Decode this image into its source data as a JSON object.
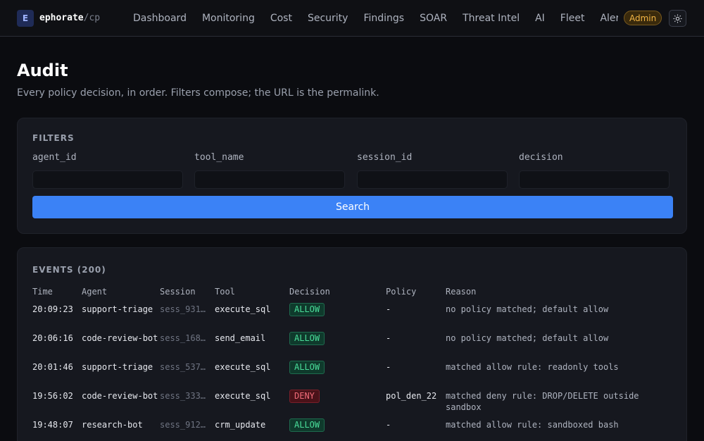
{
  "brand": {
    "logo_letter": "E",
    "name": "ephorate",
    "sep": "/",
    "sub": "cp"
  },
  "nav": [
    {
      "label": "Dashboard"
    },
    {
      "label": "Monitoring"
    },
    {
      "label": "Cost"
    },
    {
      "label": "Security"
    },
    {
      "label": "Findings"
    },
    {
      "label": "SOAR"
    },
    {
      "label": "Threat Intel"
    },
    {
      "label": "AI"
    },
    {
      "label": "Fleet"
    },
    {
      "label": "Aler"
    }
  ],
  "admin_badge": "Admin",
  "theme_icon": "sun-icon",
  "page": {
    "title": "Audit",
    "subtitle": "Every policy decision, in order. Filters compose; the URL is the permalink."
  },
  "filters": {
    "heading": "FILTERS",
    "fields": [
      {
        "label": "agent_id",
        "value": ""
      },
      {
        "label": "tool_name",
        "value": ""
      },
      {
        "label": "session_id",
        "value": ""
      },
      {
        "label": "decision",
        "value": ""
      }
    ],
    "search_label": "Search"
  },
  "events": {
    "heading": "EVENTS (200)",
    "columns": [
      "Time",
      "Agent",
      "Session",
      "Tool",
      "Decision",
      "Policy",
      "Reason"
    ],
    "rows": [
      {
        "time": "20:09:23",
        "agent": "support-triage",
        "session": "sess_931…",
        "tool": "execute_sql",
        "decision": "ALLOW",
        "policy": "-",
        "reason": "no policy matched; default allow"
      },
      {
        "time": "20:06:16",
        "agent": "code-review-bot",
        "session": "sess_168…",
        "tool": "send_email",
        "decision": "ALLOW",
        "policy": "-",
        "reason": "no policy matched; default allow"
      },
      {
        "time": "20:01:46",
        "agent": "support-triage",
        "session": "sess_537…",
        "tool": "execute_sql",
        "decision": "ALLOW",
        "policy": "-",
        "reason": "matched allow rule: readonly tools"
      },
      {
        "time": "19:56:02",
        "agent": "code-review-bot",
        "session": "sess_333…",
        "tool": "execute_sql",
        "decision": "DENY",
        "policy": "pol_den_22",
        "reason": "matched deny rule: DROP/DELETE outside sandbox"
      },
      {
        "time": "19:48:07",
        "agent": "research-bot",
        "session": "sess_912…",
        "tool": "crm_update",
        "decision": "ALLOW",
        "policy": "-",
        "reason": "matched allow rule: sandboxed bash"
      }
    ]
  },
  "colors": {
    "accent": "#3b82f6",
    "allow": "#4ade9a",
    "deny": "#f06b78",
    "admin": "#f3b544"
  }
}
